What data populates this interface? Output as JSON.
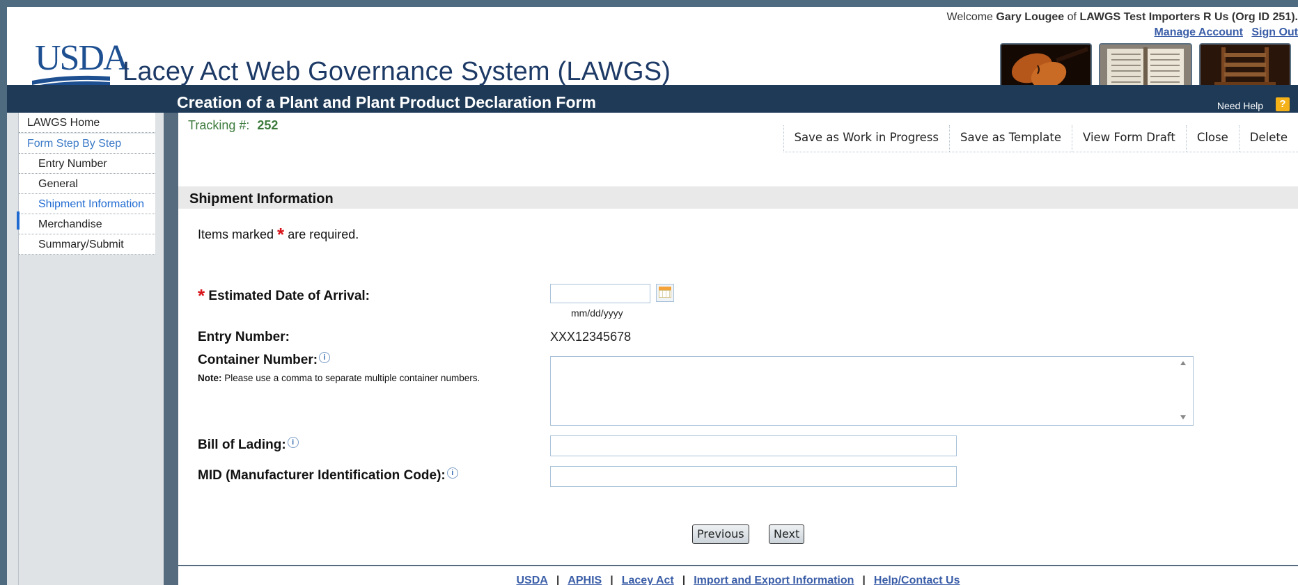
{
  "header": {
    "welcome_prefix": "Welcome",
    "user_name": "Gary Lougee",
    "of": "of",
    "org": "LAWGS Test Importers R Us (Org ID 251).",
    "manage_account": "Manage Account",
    "sign_out": "Sign Out",
    "logo_text": "USDA",
    "app_title": "Lacey Act Web Governance System (LAWGS)",
    "form_title": "Creation of a Plant and Plant Product Declaration Form",
    "need_help": "Need Help",
    "help_glyph": "?"
  },
  "sidebar": {
    "items": [
      {
        "label": "LAWGS Home"
      },
      {
        "label": "Form Step By Step"
      },
      {
        "label": "Entry Number"
      },
      {
        "label": "General"
      },
      {
        "label": "Shipment Information"
      },
      {
        "label": "Merchandise"
      },
      {
        "label": "Summary/Submit"
      }
    ],
    "active": "Shipment Information"
  },
  "tracking": {
    "label": "Tracking #:",
    "value": "252"
  },
  "actions": {
    "save_wip": "Save as Work in Progress",
    "save_template": "Save as Template",
    "view_draft": "View Form Draft",
    "close": "Close",
    "delete": "Delete"
  },
  "section": {
    "title": "Shipment Information",
    "required_prefix": "Items marked",
    "required_suffix": "are required.",
    "required_mark": "*"
  },
  "fields": {
    "eta_label": "Estimated Date of Arrival:",
    "eta_value": "",
    "eta_hint": "mm/dd/yyyy",
    "entry_label": "Entry Number:",
    "entry_value": "XXX12345678",
    "container_label": "Container Number:",
    "container_note_bold": "Note:",
    "container_note": "Please use a comma to separate multiple container numbers.",
    "container_value": "",
    "bol_label": "Bill of Lading:",
    "bol_value": "",
    "mid_label": "MID (Manufacturer Identification Code):",
    "mid_value": ""
  },
  "buttons": {
    "previous": "Previous",
    "next": "Next"
  },
  "footer": {
    "links": [
      "USDA",
      "APHIS",
      "Lacey Act",
      "Import and Export Information",
      "Help/Contact Us"
    ],
    "separator": "|"
  },
  "icons": {
    "calendar": "calendar-icon",
    "info": "info-icon",
    "help": "help-icon"
  },
  "colors": {
    "title_bar": "#1e3a57",
    "sidebar_active": "#1f6ad1",
    "required": "#d8141a",
    "tracking_green": "#3c7a3c",
    "link_blue": "#3b5ea8",
    "help_orange": "#f5b118"
  }
}
